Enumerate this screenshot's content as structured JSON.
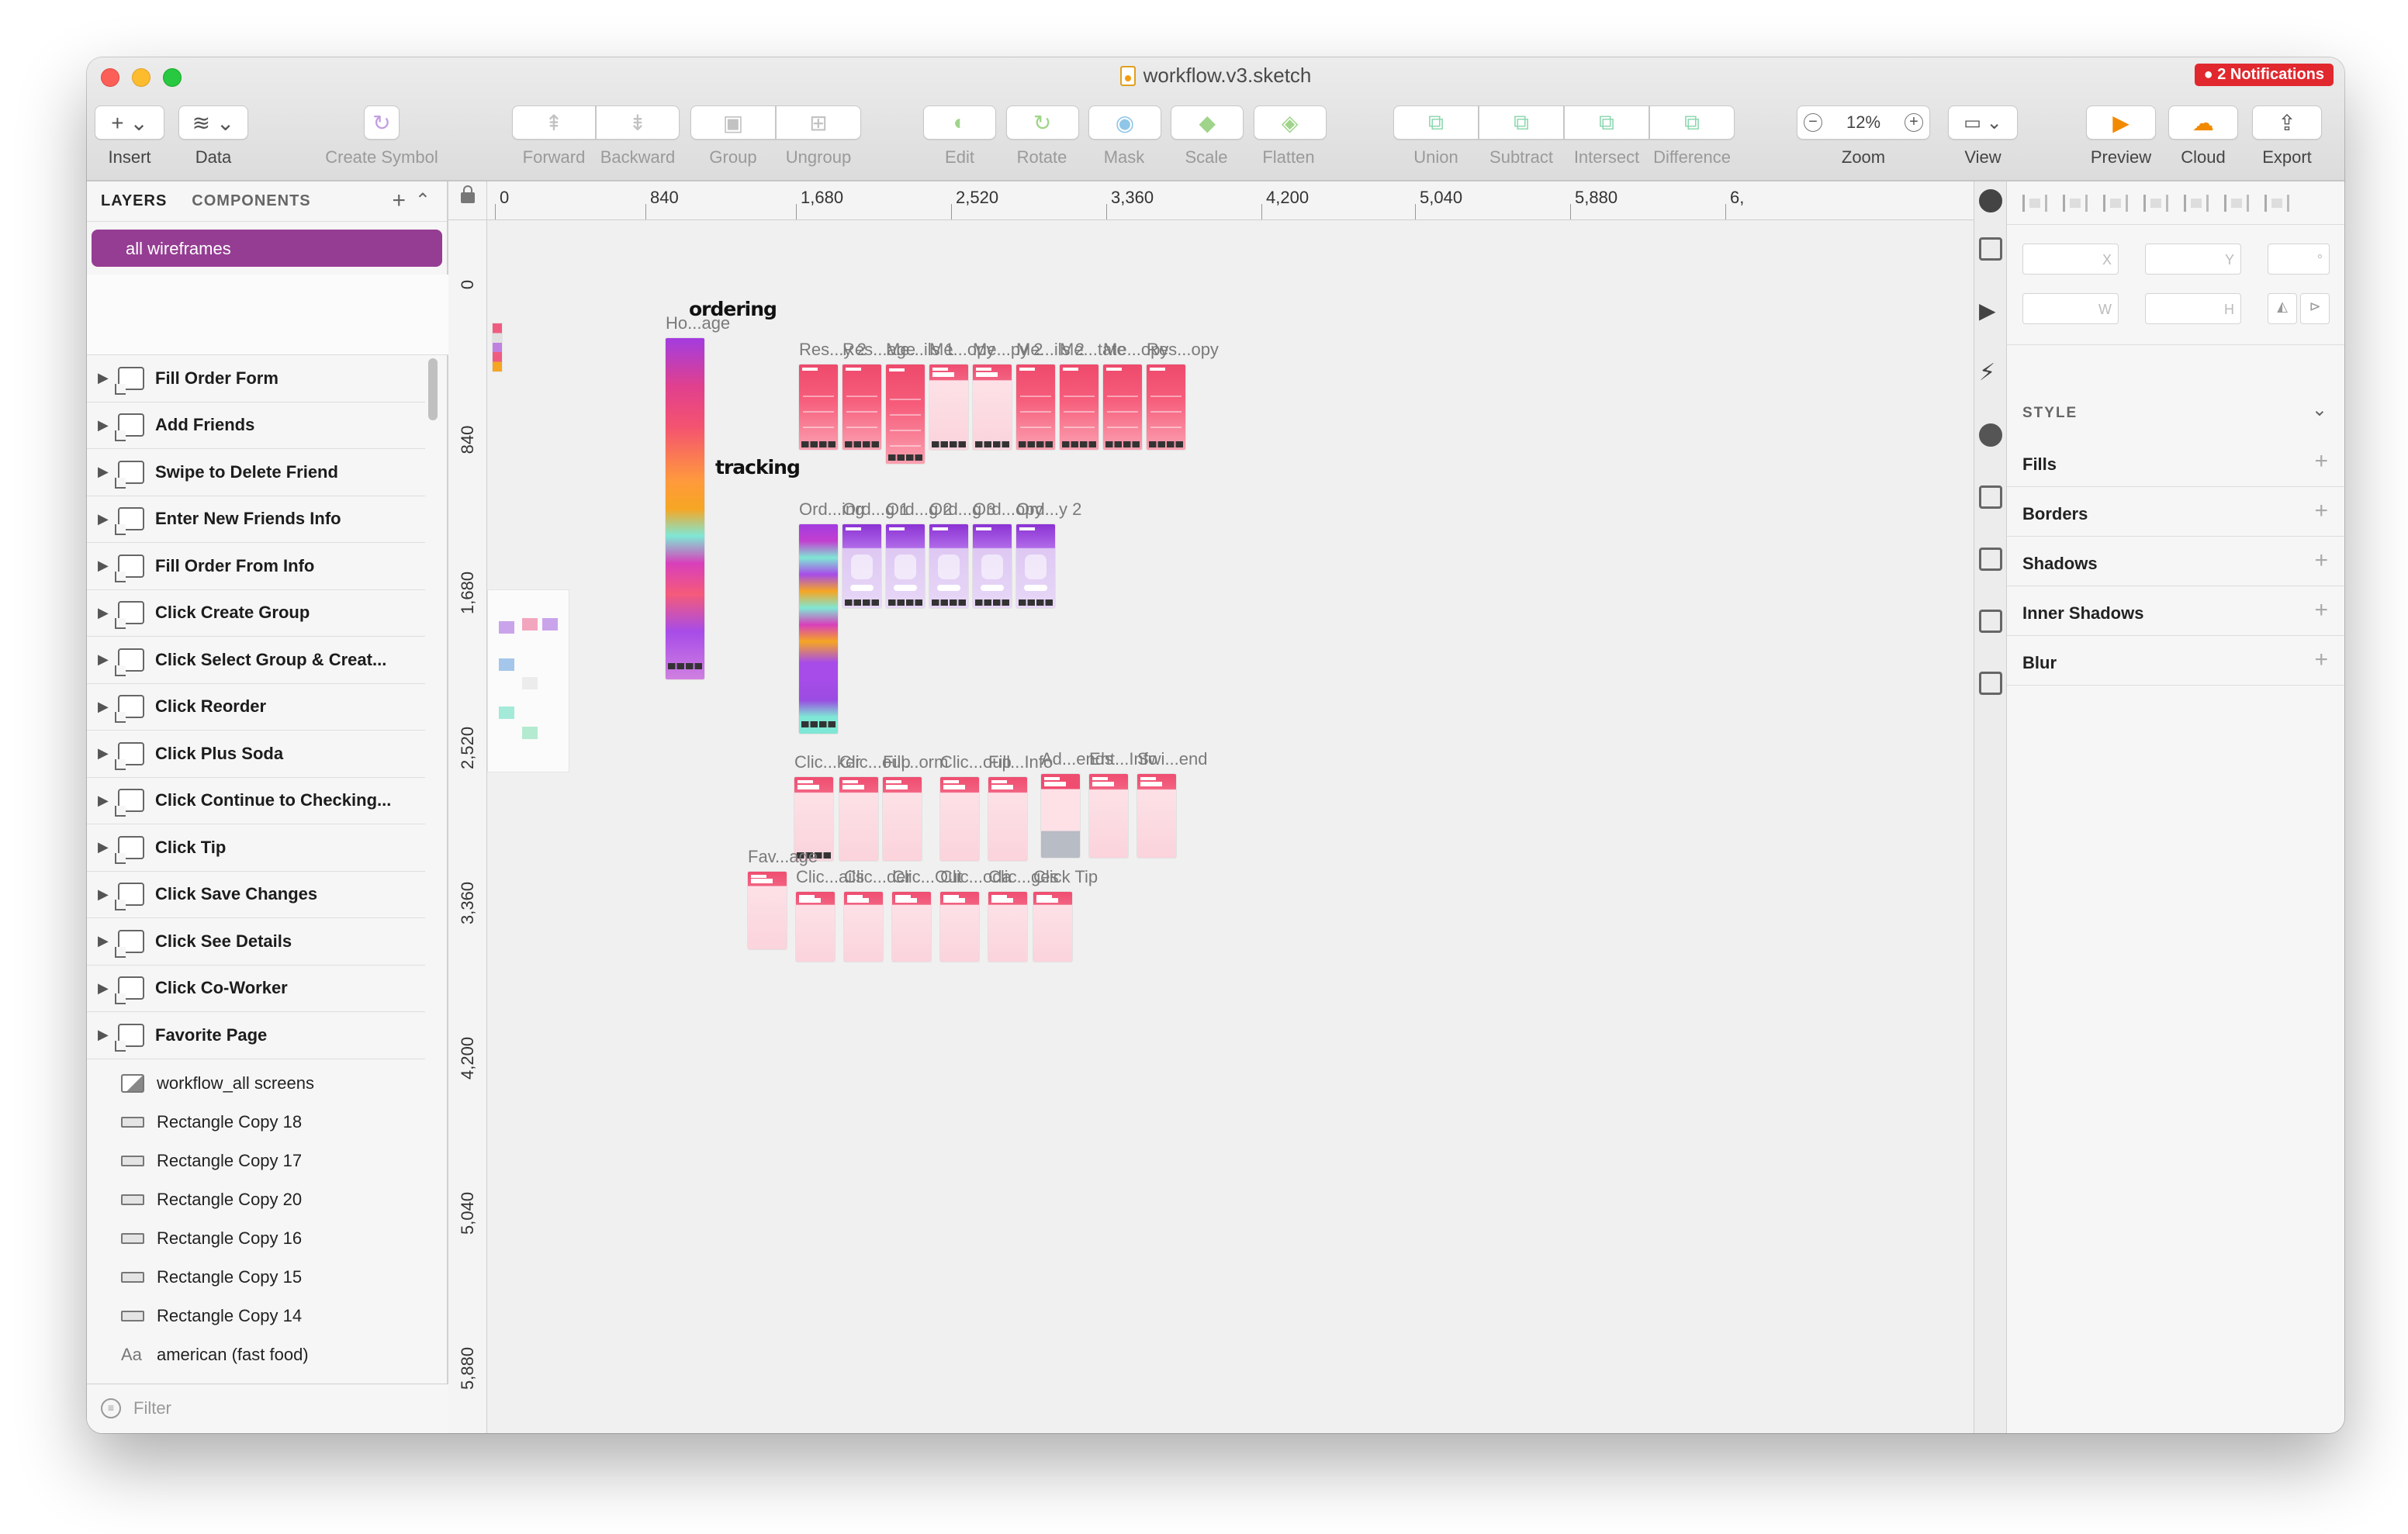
{
  "window": {
    "title": "workflow.v3.sketch",
    "notifications": "2 Notifications"
  },
  "toolbar": {
    "insert": "Insert",
    "data": "Data",
    "create_symbol": "Create Symbol",
    "forward": "Forward",
    "backward": "Backward",
    "group": "Group",
    "ungroup": "Ungroup",
    "edit": "Edit",
    "rotate": "Rotate",
    "mask": "Mask",
    "scale": "Scale",
    "flatten": "Flatten",
    "union": "Union",
    "subtract": "Subtract",
    "intersect": "Intersect",
    "difference": "Difference",
    "zoom_value": "12%",
    "zoom": "Zoom",
    "view": "View",
    "preview": "Preview",
    "cloud": "Cloud",
    "export": "Export"
  },
  "left_panel": {
    "tab_layers": "LAYERS",
    "tab_components": "COMPONENTS",
    "selected_page": "all wireframes",
    "artboards": [
      "Fill Order Form",
      "Add Friends",
      "Swipe to Delete Friend",
      "Enter New Friends Info",
      "Fill Order From Info",
      "Click Create Group",
      "Click Select Group & Creat...",
      "Click Reorder",
      "Click Plus Soda",
      "Click Continue to Checking...",
      "Click Tip",
      "Click Save Changes",
      "Click See Details",
      "Click Co-Worker",
      "Favorite Page"
    ],
    "layers": [
      {
        "name": "workflow_all screens",
        "icon": "image-icon"
      },
      {
        "name": "Rectangle Copy 18",
        "icon": "rectangle-icon"
      },
      {
        "name": "Rectangle Copy 17",
        "icon": "rectangle-icon"
      },
      {
        "name": "Rectangle Copy 20",
        "icon": "rectangle-icon"
      },
      {
        "name": "Rectangle Copy 16",
        "icon": "rectangle-icon"
      },
      {
        "name": "Rectangle Copy 15",
        "icon": "rectangle-icon"
      },
      {
        "name": "Rectangle Copy 14",
        "icon": "rectangle-icon"
      },
      {
        "name": "american (fast food)",
        "icon": "text-icon",
        "prefix": "Aa"
      }
    ],
    "filter_placeholder": "Filter"
  },
  "rulers": {
    "h": [
      "0",
      "840",
      "1,680",
      "2,520",
      "3,360",
      "4,200",
      "5,040",
      "5,880",
      "6,"
    ],
    "v": [
      "0",
      "840",
      "1,680",
      "2,520",
      "3,360",
      "4,200",
      "5,040",
      "5,880"
    ]
  },
  "canvas": {
    "groups": {
      "ordering": "ordering",
      "tracking": "tracking"
    },
    "home_label": "Ho...age",
    "ordering_row": [
      "Res...y 2",
      "Res...age",
      "Me...ils 1",
      "Me...opy",
      "Me...py 2",
      "Me...ils 2",
      "Me...tate",
      "Me...opy",
      "Res...opy"
    ],
    "tracking_strip": "Ord...ing",
    "tracking_row": [
      "Ord...g 1",
      "Ord...g 2",
      "Ord...g 3",
      "Ord...opy",
      "Ord...y 2"
    ],
    "group_row": [
      "Clic...ker",
      "Clic...oup",
      "Fill...orm",
      "Clic...oup",
      "Fill...Info",
      "Ad...ends",
      "Ent...Info",
      "Swi...end"
    ],
    "favorite": "Fav...age",
    "bottom_row": [
      "Clic...ails",
      "Clic...der",
      "Clic...Out",
      "Clic...oda",
      "Clic...ges",
      "Click Tip"
    ]
  },
  "inspector": {
    "x": "X",
    "y": "Y",
    "deg": "°",
    "w": "W",
    "h": "H",
    "style": "STYLE",
    "sections": [
      "Fills",
      "Borders",
      "Shadows",
      "Inner Shadows",
      "Blur"
    ]
  }
}
